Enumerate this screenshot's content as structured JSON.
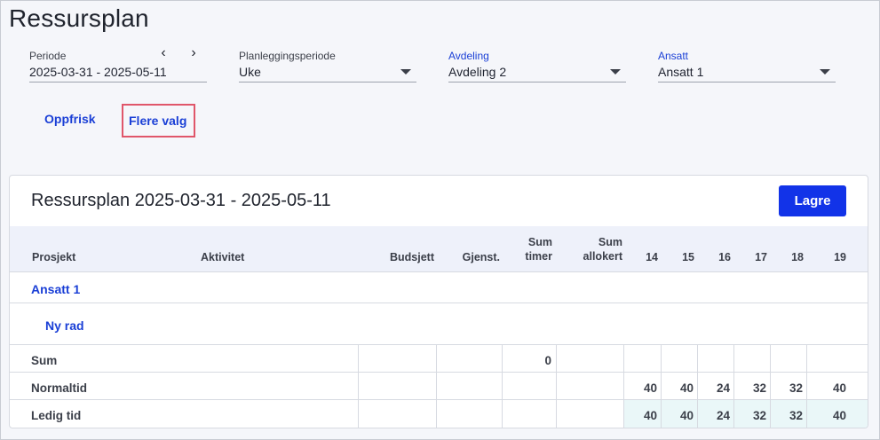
{
  "page": {
    "title": "Ressursplan"
  },
  "filters": {
    "periode": {
      "label": "Periode",
      "value": "2025-03-31 - 2025-05-11",
      "prev_icon": "chevron-left",
      "next_icon": "chevron-right"
    },
    "planleggingsperiode": {
      "label": "Planleggingsperiode",
      "value": "Uke"
    },
    "avdeling": {
      "label": "Avdeling",
      "value": "Avdeling 2"
    },
    "ansatt": {
      "label": "Ansatt",
      "value": "Ansatt 1"
    }
  },
  "actions": {
    "refresh": "Oppfrisk",
    "more": "Flere valg"
  },
  "card": {
    "title": "Ressursplan 2025-03-31 - 2025-05-11",
    "save": "Lagre"
  },
  "table": {
    "headers": {
      "prosjekt": "Prosjekt",
      "aktivitet": "Aktivitet",
      "budsjett": "Budsjett",
      "gjenst": "Gjenst.",
      "sum_timer_1": "Sum",
      "sum_timer_2": "timer",
      "sum_allokert_1": "Sum",
      "sum_allokert_2": "allokert",
      "weeks": [
        "14",
        "15",
        "16",
        "17",
        "18",
        "19"
      ]
    },
    "group": "Ansatt 1",
    "new_row": "Ny rad",
    "rows": {
      "sum": {
        "label": "Sum",
        "sum_timer": "0"
      },
      "normaltid": {
        "label": "Normaltid",
        "weeks": [
          "40",
          "40",
          "24",
          "32",
          "32",
          "40"
        ]
      },
      "ledig": {
        "label": "Ledig tid",
        "weeks": [
          "40",
          "40",
          "24",
          "32",
          "32",
          "40"
        ]
      }
    }
  },
  "colors": {
    "accent": "#1233e8",
    "link": "#1a3fd6",
    "highlight": "#e0566a",
    "ledig_bg": "#eaf7f8"
  }
}
